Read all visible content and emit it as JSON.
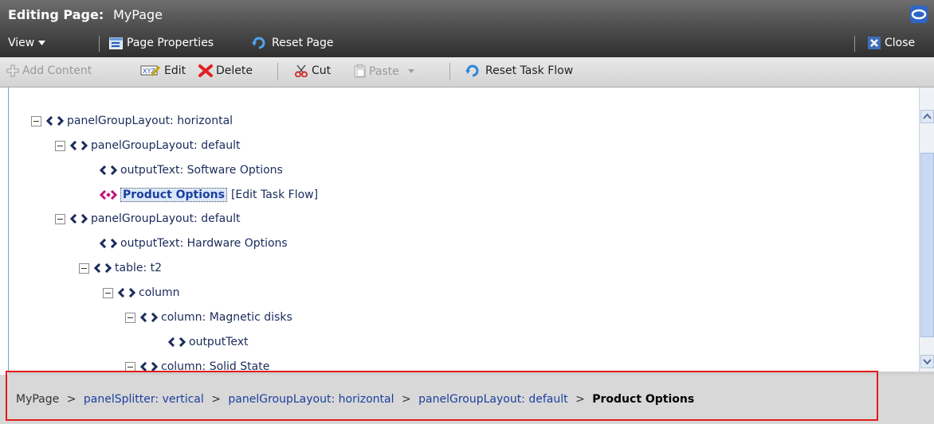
{
  "header": {
    "title_prefix": "Editing Page:",
    "title_name": "MyPage",
    "logo_icon": "oracle-logo-icon"
  },
  "menubar": {
    "view_label": "View",
    "page_properties_label": "Page Properties",
    "reset_page_label": "Reset Page",
    "close_label": "Close"
  },
  "toolbar": {
    "add_content_label": "Add Content",
    "edit_label": "Edit",
    "delete_label": "Delete",
    "cut_label": "Cut",
    "paste_label": "Paste",
    "reset_task_flow_label": "Reset Task Flow"
  },
  "tree": {
    "nodes": [
      {
        "label": "panelGroupLayout: horizontal",
        "expandable": true
      },
      {
        "label": "panelGroupLayout: default",
        "expandable": true
      },
      {
        "label": "outputText: Software Options",
        "expandable": false
      },
      {
        "label": "Product Options",
        "expandable": false,
        "selected": true,
        "action": "[Edit Task Flow]"
      },
      {
        "label": "panelGroupLayout: default",
        "expandable": true
      },
      {
        "label": "outputText: Hardware Options",
        "expandable": false
      },
      {
        "label": "table: t2",
        "expandable": true
      },
      {
        "label": "column",
        "expandable": true
      },
      {
        "label": "column: Magnetic disks",
        "expandable": true
      },
      {
        "label": "outputText",
        "expandable": false
      },
      {
        "label": "column: Solid State",
        "expandable": true
      }
    ]
  },
  "breadcrumb": {
    "items": [
      "MyPage",
      "panelSplitter: vertical",
      "panelGroupLayout: horizontal",
      "panelGroupLayout: default"
    ],
    "separator": ">",
    "current": "Product Options"
  },
  "colors": {
    "title_bar": "#5a5a5a",
    "menu_bar": "#3a3a3a",
    "selection_highlight": "#dbe8fb",
    "annotation_border": "#e21b1b"
  }
}
